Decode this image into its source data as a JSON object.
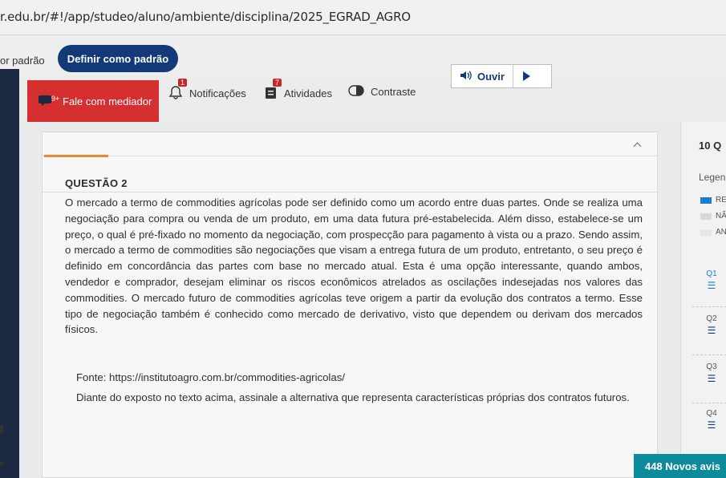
{
  "browser": {
    "url": "r.edu.br/#!/app/studeo/aluno/ambiente/disciplina/2025_EGRAD_AGRO"
  },
  "toolbar1": {
    "default_text": "or padrão",
    "default_button": "Definir como padrão"
  },
  "toolbar2": {
    "mediator_badge": "9+",
    "mediator_button": "Fale com mediador",
    "notifications_badge": "1",
    "notifications_label": "Notificações",
    "activities_badge": "7",
    "activities_label": "Atividades",
    "contrast_label": "Contraste",
    "listen_label": "Ouvir"
  },
  "question": {
    "title": "QUESTÃO 2",
    "text": "O mercado a termo de commodities agrícolas pode ser definido como um acordo entre duas partes. Onde se realiza uma negociação para compra ou venda de um produto, em uma data futura pré-estabelecida. Além disso, estabelece-se um preço, o qual é pré-fixado no momento da negociação, com prospecção para pagamento à vista ou a prazo. Sendo assim, o mercado a termo de commodities são negociações que visam a entrega futura de um produto, entretanto, o seu preço é definido em concordância das partes com base no mercado atual. Esta é uma opção interessante, quando ambos, vendedor e comprador, desejam eliminar os riscos econômicos atrelados as oscilações indesejadas nos valores das commodities. O mercado futuro de commodities agrícolas teve origem a partir da evolução dos contratos a termo. Esse tipo de negociação também é conhecido como mercado de derivativo, visto que dependem ou derivam dos mercados físicos.",
    "source": "Fonte: https://institutoagro.com.br/commodities-agricolas/",
    "command": "Diante do exposto no texto acima, assinale a alternativa que representa características próprias dos contratos futuros."
  },
  "sidebar": {
    "count": "10 Q",
    "legend_title": "Legen",
    "legend": [
      {
        "label": "RE",
        "color": "#1c7ec8"
      },
      {
        "label": "NÃ",
        "color": "#d9d9d9"
      },
      {
        "label": "AN",
        "color": "#e6e6e6"
      }
    ],
    "questions": [
      {
        "label": "Q1",
        "active": true
      },
      {
        "label": "Q2",
        "active": false
      },
      {
        "label": "Q3",
        "active": false
      },
      {
        "label": "Q4",
        "active": false
      }
    ],
    "notices": "448 Novos avis"
  },
  "colors": {
    "primary_blue": "#123a78",
    "mediator_red": "#d62f30",
    "accent_orange": "#e8892f",
    "notice_teal": "#0e8b9a"
  }
}
